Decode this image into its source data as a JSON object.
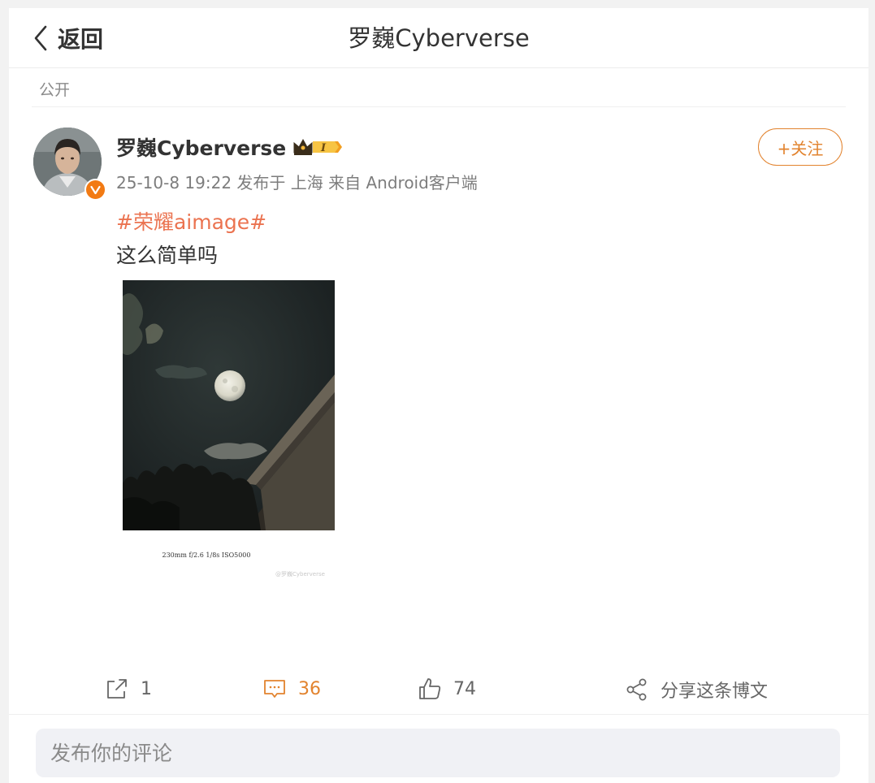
{
  "header": {
    "back_label": "返回",
    "title": "罗巍Cyberverse"
  },
  "visibility": "公开",
  "post": {
    "username": "罗巍Cyberverse",
    "badge_level": "I",
    "meta": "25-10-8 19:22 发布于 上海 来自 Android客户端",
    "follow_label": "+关注",
    "hashtag": "#荣耀aimage#",
    "text": "这么简单吗",
    "image": {
      "exif": "230mm  f/2.6  1/8s  ISO5000",
      "watermark": "@罗巍Cyberverse"
    },
    "verified_icon": "verified-v-badge-icon",
    "crown_icon": "crown-icon"
  },
  "actions": {
    "repost_count": "1",
    "comment_count": "36",
    "like_count": "74",
    "share_label": "分享这条博文"
  },
  "comment": {
    "placeholder": "发布你的评论"
  },
  "colors": {
    "accent": "#e2832e",
    "hashtag": "#eb7350",
    "verified": "#f27a13"
  }
}
